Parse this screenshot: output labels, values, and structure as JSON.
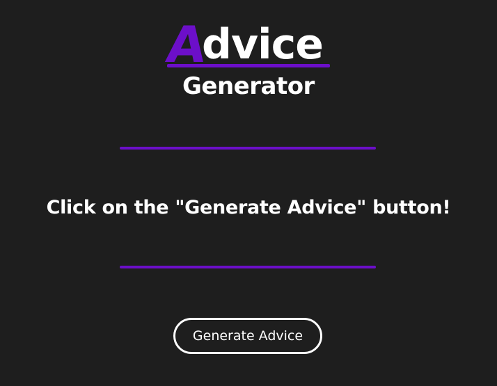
{
  "logo": {
    "first_letter": "A",
    "rest_of_title": "dvice",
    "subtitle": "Generator"
  },
  "advice": {
    "text": "Click on the \"Generate Advice\" button!"
  },
  "button": {
    "label": "Generate Advice"
  },
  "colors": {
    "background": "#1e1e1e",
    "accent": "#6c0fc9",
    "text": "#ffffff"
  }
}
